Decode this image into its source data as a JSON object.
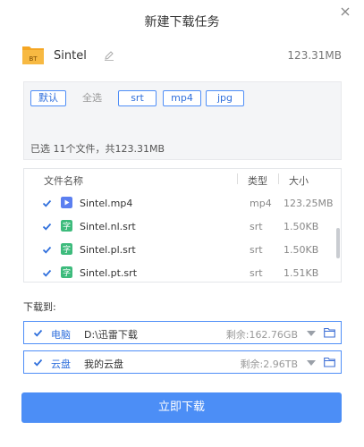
{
  "dialog": {
    "title": "新建下载任务"
  },
  "torrent": {
    "name": "Sintel",
    "size": "123.31MB",
    "icon_label": "BT"
  },
  "filters": {
    "chips": [
      {
        "label": "默认",
        "active": true
      },
      {
        "label": "全选",
        "active": false
      },
      {
        "label": "srt",
        "active": true
      },
      {
        "label": "mp4",
        "active": true
      },
      {
        "label": "jpg",
        "active": true
      }
    ],
    "selected_info": "已选 11个文件，共123.31MB"
  },
  "file_list": {
    "headers": {
      "name": "文件名称",
      "type": "类型",
      "size": "大小"
    },
    "rows": [
      {
        "name": "Sintel.mp4",
        "type": "mp4",
        "size": "123.25MB",
        "icon": "video-file-icon",
        "checked": true
      },
      {
        "name": "Sintel.nl.srt",
        "type": "srt",
        "size": "1.50KB",
        "icon": "subtitle-file-icon",
        "checked": true
      },
      {
        "name": "Sintel.pl.srt",
        "type": "srt",
        "size": "1.50KB",
        "icon": "subtitle-file-icon",
        "checked": true
      },
      {
        "name": "Sintel.pt.srt",
        "type": "srt",
        "size": "1.51KB",
        "icon": "subtitle-file-icon",
        "checked": true
      }
    ],
    "subtitle_icon_glyph": "字"
  },
  "destinations": {
    "label": "下载到:",
    "items": [
      {
        "name": "电脑",
        "path": "D:\\迅雷下载",
        "free": "剩余:162.76GB",
        "checked": true
      },
      {
        "name": "云盘",
        "path": "我的云盘",
        "free": "剩余:2.96TB",
        "checked": true
      }
    ]
  },
  "actions": {
    "start_label": "立即下载"
  },
  "colors": {
    "accent": "#4c8ef6",
    "chip_border": "#4f8ef7",
    "video_icon": "#5b7ff0",
    "subtitle_icon": "#3dbb7c",
    "bt_folder": "#f5a623"
  }
}
